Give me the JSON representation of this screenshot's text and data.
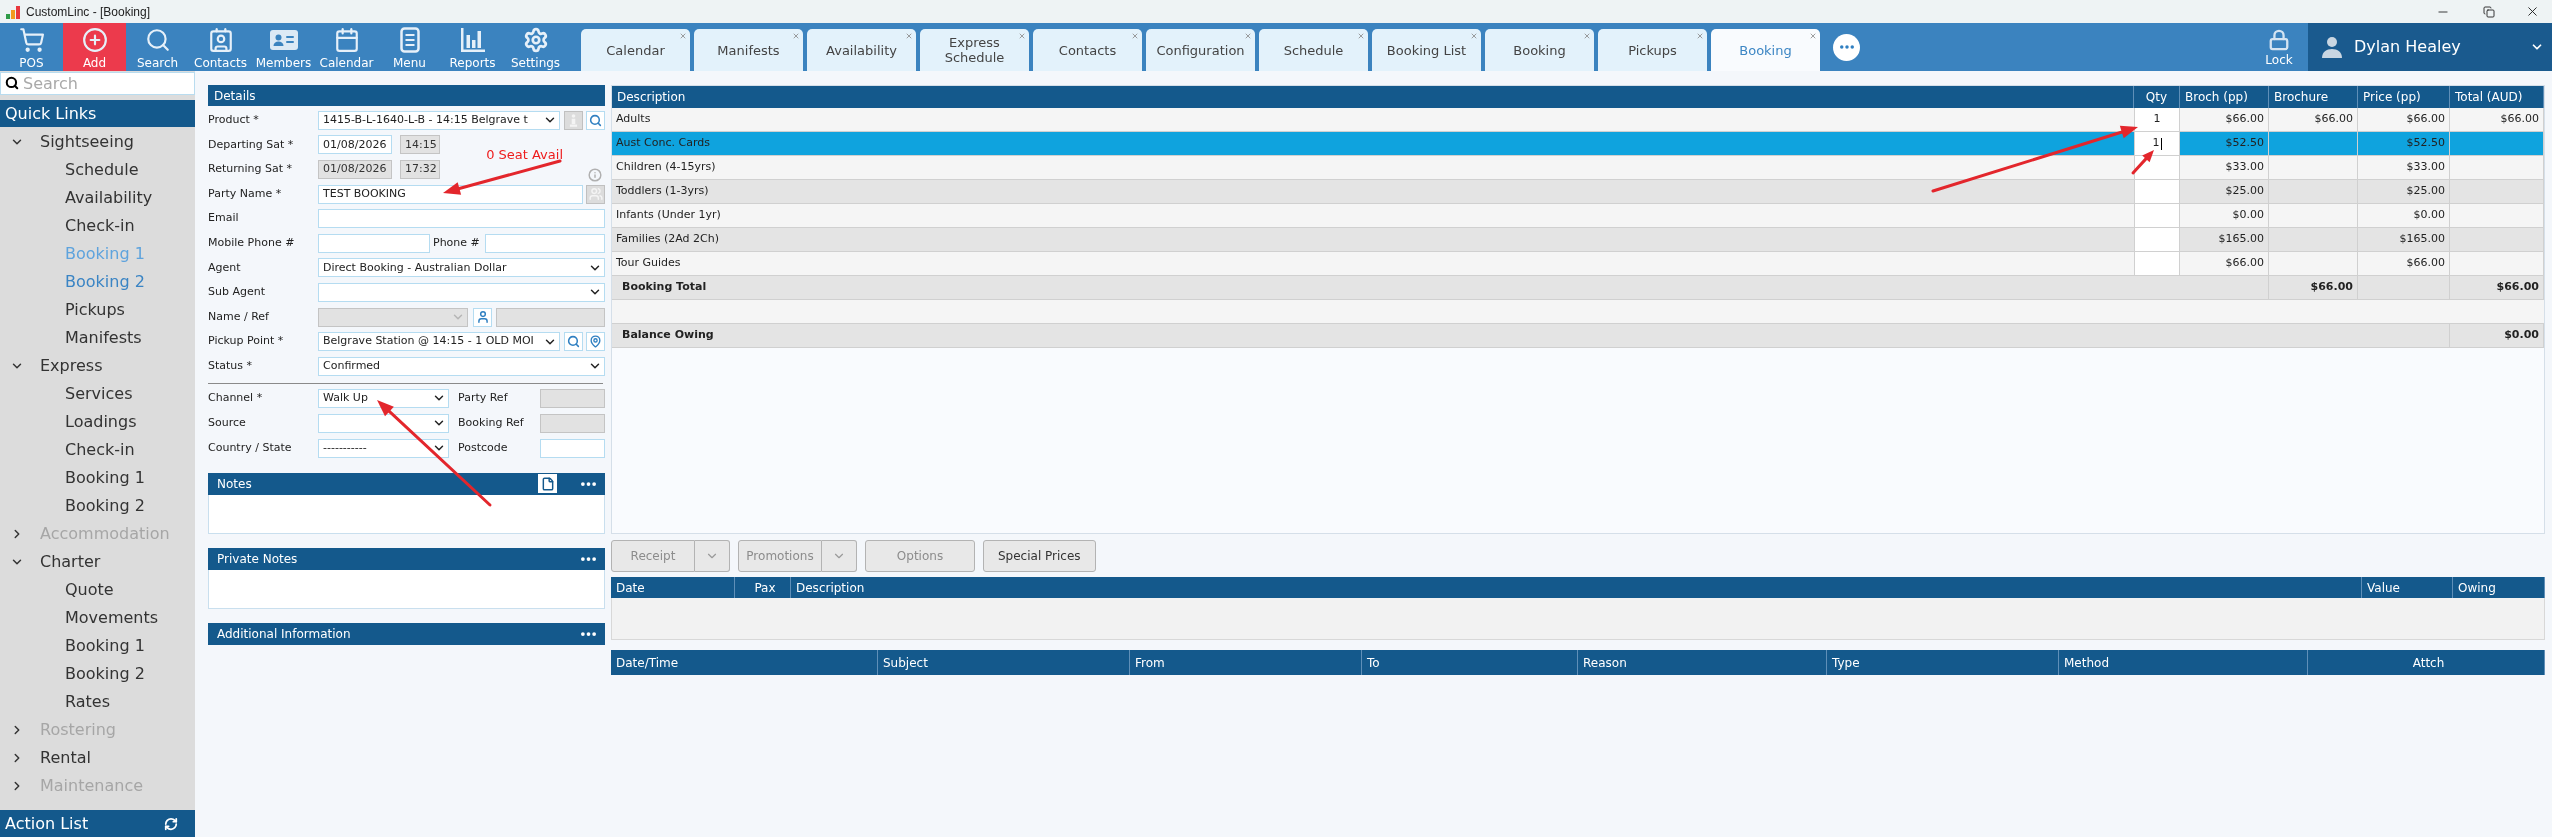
{
  "window": {
    "title": "CustomLinc - [Booking]"
  },
  "toolbar": [
    {
      "label": "POS",
      "highlighted": false
    },
    {
      "label": "Add",
      "highlighted": true
    },
    {
      "label": "Search",
      "highlighted": false
    },
    {
      "label": "Contacts",
      "highlighted": false
    },
    {
      "label": "Members",
      "highlighted": false
    },
    {
      "label": "Calendar",
      "highlighted": false
    },
    {
      "label": "Menu",
      "highlighted": false
    },
    {
      "label": "Reports",
      "highlighted": false
    },
    {
      "label": "Settings",
      "highlighted": false
    }
  ],
  "tabs": [
    {
      "label": "Calendar",
      "selected": false
    },
    {
      "label": "Manifests",
      "selected": false
    },
    {
      "label": "Availability",
      "selected": false
    },
    {
      "label": "Express Schedule",
      "selected": false
    },
    {
      "label": "Contacts",
      "selected": false
    },
    {
      "label": "Configuration",
      "selected": false
    },
    {
      "label": "Schedule",
      "selected": false
    },
    {
      "label": "Booking List",
      "selected": false
    },
    {
      "label": "Booking",
      "selected": false
    },
    {
      "label": "Pickups",
      "selected": false
    },
    {
      "label": "Booking",
      "selected": true
    }
  ],
  "lock": {
    "label": "Lock"
  },
  "user": {
    "name": "Dylan Healey"
  },
  "sidebar": {
    "search": {
      "placeholder": "Search"
    },
    "title": "Quick Links",
    "groups": [
      {
        "label": "Sightseeing",
        "expanded": true,
        "disabled": false,
        "children": [
          {
            "label": "Schedule",
            "selected": false,
            "hovered": false
          },
          {
            "label": "Availability",
            "selected": false,
            "hovered": false
          },
          {
            "label": "Check-in",
            "selected": false,
            "hovered": false
          },
          {
            "label": "Booking 1",
            "selected": false,
            "hovered": true
          },
          {
            "label": "Booking 2",
            "selected": true,
            "hovered": false
          },
          {
            "label": "Pickups",
            "selected": false,
            "hovered": false
          },
          {
            "label": "Manifests",
            "selected": false,
            "hovered": false
          }
        ]
      },
      {
        "label": "Express",
        "expanded": true,
        "disabled": false,
        "children": [
          {
            "label": "Services",
            "selected": false,
            "hovered": false
          },
          {
            "label": "Loadings",
            "selected": false,
            "hovered": false
          },
          {
            "label": "Check-in",
            "selected": false,
            "hovered": false
          },
          {
            "label": "Booking 1",
            "selected": false,
            "hovered": false
          },
          {
            "label": "Booking 2",
            "selected": false,
            "hovered": false
          }
        ]
      },
      {
        "label": "Accommodation",
        "expanded": false,
        "disabled": true
      },
      {
        "label": "Charter",
        "expanded": true,
        "disabled": false,
        "children": [
          {
            "label": "Quote",
            "selected": false,
            "hovered": false
          },
          {
            "label": "Movements",
            "selected": false,
            "hovered": false
          },
          {
            "label": "Booking 1",
            "selected": false,
            "hovered": false
          },
          {
            "label": "Booking 2",
            "selected": false,
            "hovered": false
          },
          {
            "label": "Rates",
            "selected": false,
            "hovered": false
          }
        ]
      },
      {
        "label": "Rostering",
        "expanded": false,
        "disabled": true
      },
      {
        "label": "Rental",
        "expanded": false,
        "disabled": false
      },
      {
        "label": "Maintenance",
        "expanded": false,
        "disabled": true
      }
    ],
    "footer": "Action List"
  },
  "details": {
    "title": "Details",
    "product": {
      "label": "Product *",
      "value": "1415-B-L-1640-L-B - 14:15 Belgrave t"
    },
    "departing": {
      "label": "Departing Sat *",
      "date": {
        "value": "01/08/2026",
        "disabled": false
      },
      "time": {
        "value": "14:15",
        "disabled": true
      }
    },
    "seat_availability": "0 Seat Avail",
    "returning": {
      "label": "Returning Sat *",
      "date": {
        "value": "01/08/2026",
        "disabled": true
      },
      "time": {
        "value": "17:32",
        "disabled": true
      }
    },
    "party_name": {
      "label": "Party Name *",
      "value": "TEST BOOKING"
    },
    "email": {
      "label": "Email"
    },
    "mobile_phone": {
      "label": "Mobile Phone #"
    },
    "phone": {
      "label": "Phone #"
    },
    "agent": {
      "label": "Agent",
      "value": "Direct Booking - Australian Dollar"
    },
    "sub_agent": {
      "label": "Sub Agent"
    },
    "name_ref": {
      "label": "Name / Ref",
      "select": {
        "disabled": true
      },
      "text": {
        "disabled": true
      }
    },
    "pickup_point": {
      "label": "Pickup Point *",
      "value": "Belgrave Station @ 14:15 - 1 OLD MOI"
    },
    "status": {
      "label": "Status *",
      "value": "Confirmed"
    },
    "channel": {
      "label": "Channel *",
      "value": "Walk Up"
    },
    "party_ref": {
      "label": "Party Ref",
      "disabled": true
    },
    "source": {
      "label": "Source"
    },
    "booking_ref": {
      "label": "Booking Ref",
      "disabled": true
    },
    "country_state": {
      "label": "Country / State",
      "value": "-----------"
    },
    "postcode": {
      "label": "Postcode",
      "disabled": false
    }
  },
  "notes": {
    "title": "Notes"
  },
  "private_notes": {
    "title": "Private Notes"
  },
  "additional_information": {
    "title": "Additional Information"
  },
  "products": {
    "columns": [
      "Description",
      "Qty",
      "Broch (pp)",
      "Brochure",
      "Price (pp)",
      "Total (AUD)"
    ],
    "rows": [
      {
        "description": "Adults",
        "qty": "1",
        "broch_pp": "$66.00",
        "brochure": "$66.00",
        "price_pp": "$66.00",
        "total": "$66.00",
        "selected": false,
        "focused": false
      },
      {
        "description": "Aust Conc. Cards",
        "qty": "1",
        "broch_pp": "$52.50",
        "price_pp": "$52.50",
        "selected": true,
        "focused": true
      },
      {
        "description": "Children (4-15yrs)",
        "broch_pp": "$33.00",
        "price_pp": "$33.00",
        "selected": false,
        "focused": false
      },
      {
        "description": "Toddlers (1-3yrs)",
        "broch_pp": "$25.00",
        "price_pp": "$25.00",
        "selected": false,
        "focused": false
      },
      {
        "description": "Infants (Under 1yr)",
        "broch_pp": "$0.00",
        "price_pp": "$0.00",
        "selected": false,
        "focused": false
      },
      {
        "description": "Families (2Ad 2Ch)",
        "broch_pp": "$165.00",
        "price_pp": "$165.00",
        "selected": false,
        "focused": false
      },
      {
        "description": "Tour Guides",
        "broch_pp": "$66.00",
        "price_pp": "$66.00",
        "selected": false,
        "focused": false
      }
    ],
    "booking_total": {
      "label": "Booking Total",
      "brochure": "$66.00",
      "total": "$66.00"
    },
    "balance_owing": {
      "label": "Balance Owing",
      "total": "$0.00"
    }
  },
  "actions": [
    {
      "label": "Receipt",
      "kind": "split",
      "disabled": true
    },
    {
      "label": "Promotions",
      "kind": "split",
      "disabled": true
    },
    {
      "label": "Options",
      "kind": "plain",
      "disabled": true
    },
    {
      "label": "Special Prices",
      "kind": "plain",
      "disabled": false
    }
  ],
  "receipts": {
    "columns": [
      "Date",
      "Pax",
      "Description",
      "Value",
      "Owing"
    ]
  },
  "communications": {
    "columns": [
      "Date/Time",
      "Subject",
      "From",
      "To",
      "Reason",
      "Type",
      "Method",
      "Attch"
    ]
  }
}
